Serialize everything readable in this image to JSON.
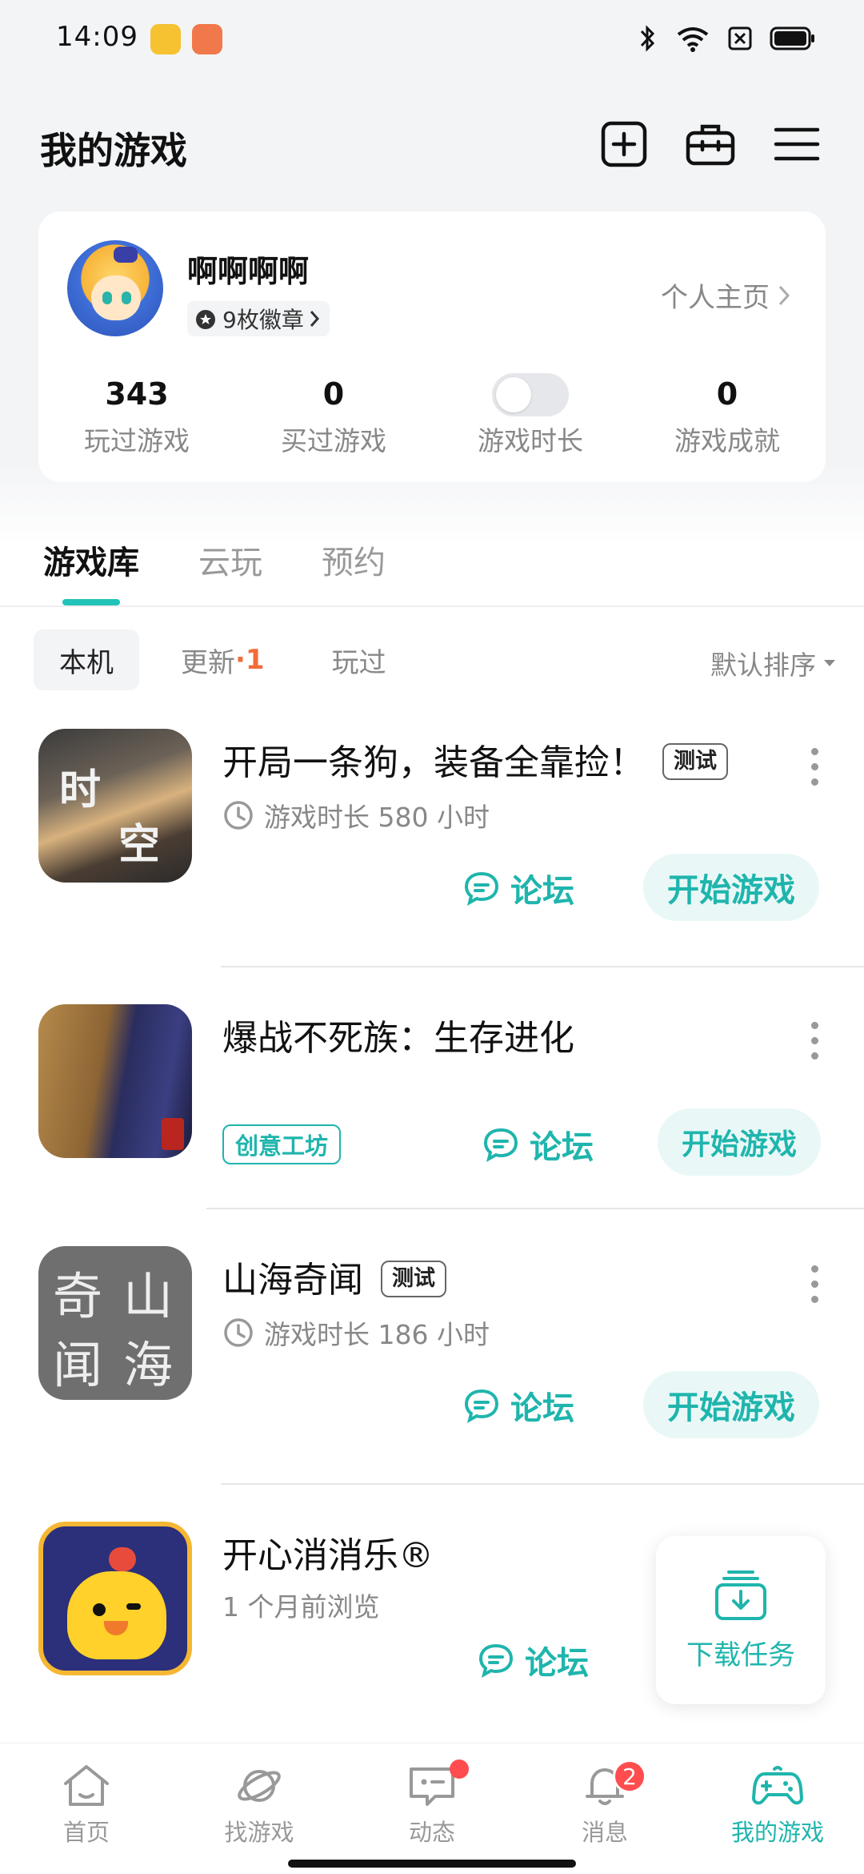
{
  "status_bar": {
    "time": "14:09"
  },
  "header": {
    "title": "我的游戏"
  },
  "profile": {
    "nickname": "啊啊啊啊",
    "badges": "9枚徽章",
    "home_link": "个人主页",
    "stats": [
      {
        "value": "343",
        "label": "玩过游戏"
      },
      {
        "value": "0",
        "label": "买过游戏"
      },
      {
        "value": "",
        "label": "游戏时长"
      },
      {
        "value": "0",
        "label": "游戏成就"
      }
    ]
  },
  "tabs": [
    "游戏库",
    "云玩",
    "预约"
  ],
  "filters": {
    "local": "本机",
    "update": "更新",
    "update_count": "·1",
    "played": "玩过",
    "sort": "默认排序"
  },
  "games": [
    {
      "title": "开局一条狗，装备全靠捡！",
      "tag": "测试",
      "sub": "游戏时长 580 小时",
      "icon_text": [
        "时",
        "空"
      ],
      "forum": "论坛",
      "play": "开始游戏"
    },
    {
      "title": "爆战不死族：生存进化",
      "workshop": "创意工坊",
      "forum": "论坛",
      "play": "开始游戏"
    },
    {
      "title": "山海奇闻",
      "tag": "测试",
      "sub": "游戏时长 186 小时",
      "icon_text": [
        "奇",
        "山",
        "闻",
        "海"
      ],
      "forum": "论坛",
      "play": "开始游戏"
    },
    {
      "title": "开心消消乐®",
      "sub": "1 个月前浏览",
      "forum": "论坛"
    }
  ],
  "download": {
    "label": "下载任务"
  },
  "nav": [
    {
      "label": "首页"
    },
    {
      "label": "找游戏"
    },
    {
      "label": "动态"
    },
    {
      "label": "消息",
      "badge": "2"
    },
    {
      "label": "我的游戏"
    }
  ],
  "colors": {
    "accent": "#1fb5ad",
    "badge": "#ff4d4f",
    "update_count": "#f26b3a"
  }
}
